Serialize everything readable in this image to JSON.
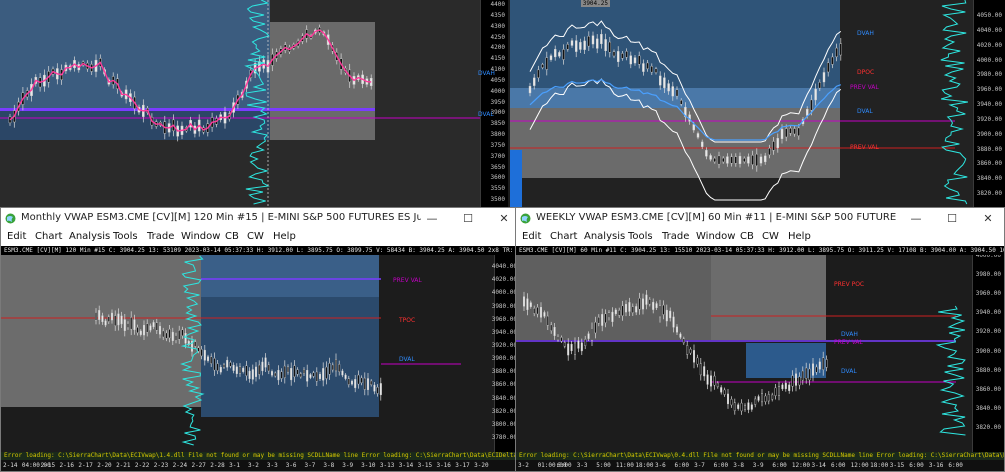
{
  "colors": {
    "accent": "#1e6fd9",
    "vwap_fill": "#3a6a9a",
    "price_pink": "#ff3a9a",
    "volume_cyan": "#2ee6e0",
    "poc_magenta": "#c400c4"
  },
  "pane_top_left": {
    "axis_ticks": [
      "4400",
      "4350",
      "4300",
      "4250",
      "4200",
      "4150",
      "4100",
      "4050",
      "4000",
      "3950",
      "3900",
      "3850",
      "3800",
      "3750",
      "3700",
      "3650",
      "3600",
      "3550",
      "3500"
    ],
    "labels": [
      "DVAH",
      "DVAL"
    ]
  },
  "pane_top_right": {
    "top_readout": "3904.25",
    "axis_ticks": [
      "4050.00",
      "4040.00",
      "4020.00",
      "4000.00",
      "3980.00",
      "3960.00",
      "3940.00",
      "3920.00",
      "3900.00",
      "3880.00",
      "3860.00",
      "3840.00",
      "3820.00"
    ],
    "labels": [
      "DVAH",
      "DPOC",
      "PREV VAL",
      "DVAL",
      "PREV VAL"
    ]
  },
  "windows": [
    {
      "title": "Monthly VWAP ESM3.CME [CV][M]  120 Min  #15 | E-MINI S&P 500 FUTURES ES Jun 2023 (J...",
      "controls": {
        "minimize": "—",
        "maximize": "☐",
        "close": "✕"
      },
      "menu": [
        "Edit",
        "Chart",
        "Analysis",
        "Tools",
        "Trade",
        "Window",
        "CB",
        "CW",
        "Help"
      ],
      "info_line": "ESM3.CME [CV][M]  120 Min  #15  C: 3904.25  13:  53109  2023-03-14 05:37:33 H: 3912.00 L: 3895.75 O: 3899.75 V: 58434 B: 3904.25 A: 3904.50 2x8 TR: 22m 26s BV: 2",
      "axis_ticks": [
        "4060.00",
        "4040.00",
        "4020.00",
        "4000.00",
        "3980.00",
        "3960.00",
        "3940.00",
        "3920.00",
        "3900.00",
        "3880.00",
        "3860.00",
        "3840.00",
        "3820.00",
        "3800.00",
        "3780.00"
      ],
      "labels": [
        "PREV VAL",
        "TPOC",
        "DVAL"
      ],
      "status_text": "Error loading: C:\\SierraChart\\Data\\ECIVwap\\1.4.dll  File not found or may be missing SCDLLName line   Error loading: C:\\SierraChart\\Data\\ECIDelta\\0.5.dll  File not found or may be m",
      "dates": [
        "2-14",
        "04:00:00",
        "2-15",
        "2-16",
        "2-17",
        "2-20",
        "2-21",
        "2-22",
        "2-23",
        "2-24",
        "2-27",
        "2-28",
        "3-1",
        "3-2",
        "3-3",
        "3-6",
        "3-7",
        "3-8",
        "3-9",
        "3-10",
        "3-13",
        "3-14",
        "3-15",
        "3-16",
        "3-17",
        "3-20"
      ]
    },
    {
      "title": "WEEKLY VWAP ESM3.CME [CV][M]  60 Min  #11 | E-MINI S&P 500 FUTURES ES Jun...",
      "controls": {
        "minimize": "—",
        "maximize": "☐",
        "close": "✕"
      },
      "menu": [
        "Edit",
        "Chart",
        "Analysis",
        "Tools",
        "Trade",
        "Window",
        "CB",
        "CW",
        "Help"
      ],
      "info_line": "ESM3.CME [CV][M]  60 Min  #11  C: 3904.25  13:  15510  2023-03-14 05:37:33 H: 3912.00 L: 3895.75 O: 3911.25 V: 17108 B: 3904.00 A: 3904.50 10x9 TR:",
      "axis_ticks": [
        "4000.00",
        "3980.00",
        "3960.00",
        "3940.00",
        "3920.00",
        "3900.00",
        "3880.00",
        "3860.00",
        "3840.00",
        "3820.00"
      ],
      "labels": [
        "PREV POC",
        "DVAH",
        "PREV VAL",
        "DVAL"
      ],
      "status_text": "Error loading: C:\\SierraChart\\Data\\ECIVwap\\0.4.dll  File not found or may be missing SCDLLName line   Error loading: C:\\SierraChart\\Data\\ECIDelta\\0.5.dll  File not found",
      "dates": [
        "3-2",
        "01:00:00",
        "6:00",
        "3-3",
        "5:00",
        "11:00",
        "18:00",
        "3-6",
        "6:00",
        "3-7",
        "6:00",
        "3-8",
        "3-9",
        "6:00",
        "12:00",
        "3-14",
        "6:00",
        "12:00",
        "18:00",
        "3-15",
        "6:00",
        "3-16",
        "6:00"
      ]
    }
  ]
}
